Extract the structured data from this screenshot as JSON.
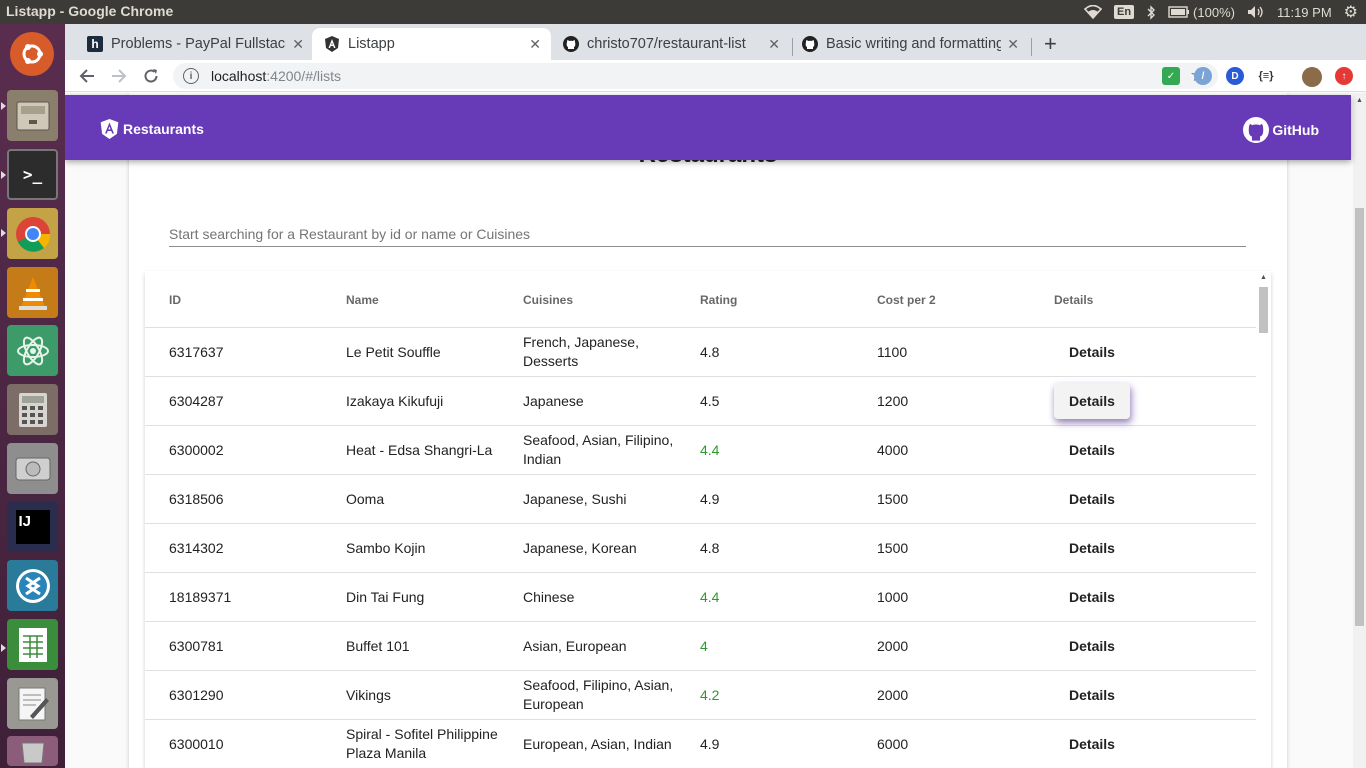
{
  "os": {
    "window_title": "Listapp - Google Chrome",
    "keyboard_layout": "En",
    "battery": "(100%)",
    "clock": "11:19 PM"
  },
  "browser": {
    "tabs": [
      {
        "label": "Problems - PayPal Fullstack",
        "icon": "hackerrank-icon"
      },
      {
        "label": "Listapp",
        "icon": "angular-icon"
      },
      {
        "label": "christo707/restaurant-list",
        "icon": "github-icon"
      },
      {
        "label": "Basic writing and formatting",
        "icon": "github-icon"
      }
    ],
    "url_host": "localhost",
    "url_path": ":4200/#/lists"
  },
  "app": {
    "brand": "Restaurants",
    "github_label": "GitHub",
    "card_title": "Restaurants",
    "search_placeholder": "Start searching for a Restaurant by id or name or Cuisines",
    "columns": [
      "ID",
      "Name",
      "Cuisines",
      "Rating",
      "Cost per 2",
      "Details"
    ],
    "rows": [
      {
        "id": "6317637",
        "name": "Le Petit Souffle",
        "cuisines": "French, Japanese, Desserts",
        "rating": "4.8",
        "cost": "1100",
        "details": "Details"
      },
      {
        "id": "6304287",
        "name": "Izakaya Kikufuji",
        "cuisines": "Japanese",
        "rating": "4.5",
        "cost": "1200",
        "details": "Details"
      },
      {
        "id": "6300002",
        "name": "Heat - Edsa Shangri-La",
        "cuisines": "Seafood, Asian, Filipino, Indian",
        "rating": "4.4",
        "cost": "4000",
        "details": "Details"
      },
      {
        "id": "6318506",
        "name": "Ooma",
        "cuisines": "Japanese, Sushi",
        "rating": "4.9",
        "cost": "1500",
        "details": "Details"
      },
      {
        "id": "6314302",
        "name": "Sambo Kojin",
        "cuisines": "Japanese, Korean",
        "rating": "4.8",
        "cost": "1500",
        "details": "Details"
      },
      {
        "id": "18189371",
        "name": "Din Tai Fung",
        "cuisines": "Chinese",
        "rating": "4.4",
        "cost": "1000",
        "details": "Details"
      },
      {
        "id": "6300781",
        "name": "Buffet 101",
        "cuisines": "Asian, European",
        "rating": "4",
        "cost": "2000",
        "details": "Details"
      },
      {
        "id": "6301290",
        "name": "Vikings",
        "cuisines": "Seafood, Filipino, Asian, European",
        "rating": "4.2",
        "cost": "2000",
        "details": "Details"
      },
      {
        "id": "6300010",
        "name": "Spiral - Sofitel Philippine Plaza Manila",
        "cuisines": "European, Asian, Indian",
        "rating": "4.9",
        "cost": "6000",
        "details": "Details"
      }
    ]
  },
  "colors": {
    "appbar": "#673ab7",
    "rating_green": "#2e9a2e",
    "rating_dark": "#222222"
  }
}
